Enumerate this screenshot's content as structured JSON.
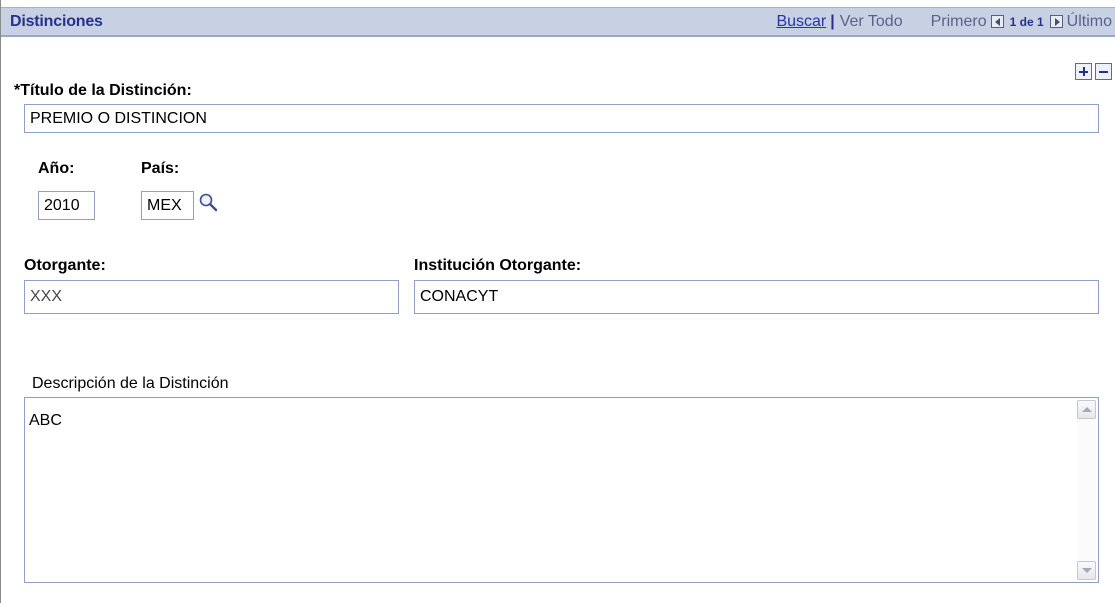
{
  "header": {
    "title": "Distinciones",
    "buscar_link": "Buscar",
    "separator": "|",
    "ver_todo": "Ver Todo",
    "primero": "Primero",
    "count": "1 de 1",
    "ultimo": "Último"
  },
  "row_controls": {
    "add_icon": "plus-icon",
    "remove_icon": "minus-icon"
  },
  "form": {
    "titulo": {
      "label": "*Título de la Distinción:",
      "value": "PREMIO O DISTINCION"
    },
    "anio": {
      "label": "Año:",
      "value": "2010"
    },
    "pais": {
      "label": "País:",
      "value": "MEX",
      "lookup_icon": "magnifier-icon"
    },
    "otorgante": {
      "label": "Otorgante:",
      "value": "XXX"
    },
    "institucion": {
      "label": "Institución Otorgante:",
      "value": "CONACYT"
    },
    "descripcion": {
      "label": "Descripción de la Distinción",
      "value": "ABC"
    }
  },
  "colors": {
    "header_bg": "#c8d1e3",
    "header_title": "#27318c",
    "link": "#2a34a6",
    "field_border": "#8fa1c2"
  }
}
